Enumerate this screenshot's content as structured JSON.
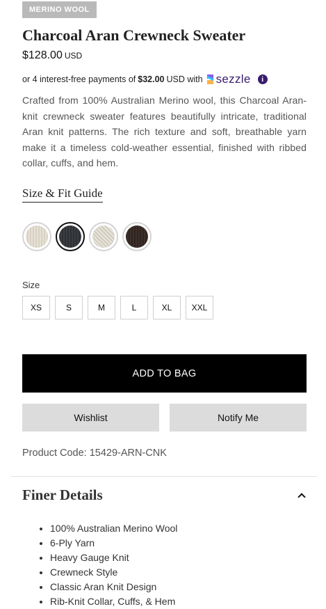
{
  "badge": "MERINO WOOL",
  "product": {
    "title": "Charcoal Aran Crewneck Sweater",
    "price": "$128.00",
    "currency": "USD"
  },
  "sezzle": {
    "prefix": "or 4 interest-free payments of",
    "amount": "$32.00",
    "suffix": "USD with",
    "brand": "sezzle",
    "info_icon": "info-icon",
    "brand_color": "#3a1d6e"
  },
  "description": "Crafted from 100% Australian Merino wool, this Charcoal Aran-knit crewneck sweater features beautifully intricate, traditional Aran knit patterns. The rich texture and soft, breathable yarn make it a timeless cold-weather essential, finished with ribbed collar, cuffs, and hem.",
  "fit_guide_label": "Size & Fit Guide",
  "swatches": [
    {
      "name": "cream",
      "selected": false
    },
    {
      "name": "charcoal",
      "selected": true
    },
    {
      "name": "natural",
      "selected": false
    },
    {
      "name": "brown",
      "selected": false
    }
  ],
  "size_label": "Size",
  "sizes": [
    "XS",
    "S",
    "M",
    "L",
    "XL",
    "XXL"
  ],
  "buttons": {
    "add_to_bag": "ADD TO BAG",
    "wishlist": "Wishlist",
    "notify": "Notify Me"
  },
  "product_code": "Product Code: 15429-ARN-CNK",
  "finer_details": {
    "title": "Finer Details",
    "toggle_icon": "chevron-up-icon",
    "items": [
      "100% Australian Merino Wool",
      "6-Ply Yarn",
      "Heavy Gauge Knit",
      "Crewneck Style",
      "Classic Aran Knit Design",
      "Rib-Knit Collar, Cuffs, & Hem"
    ]
  }
}
